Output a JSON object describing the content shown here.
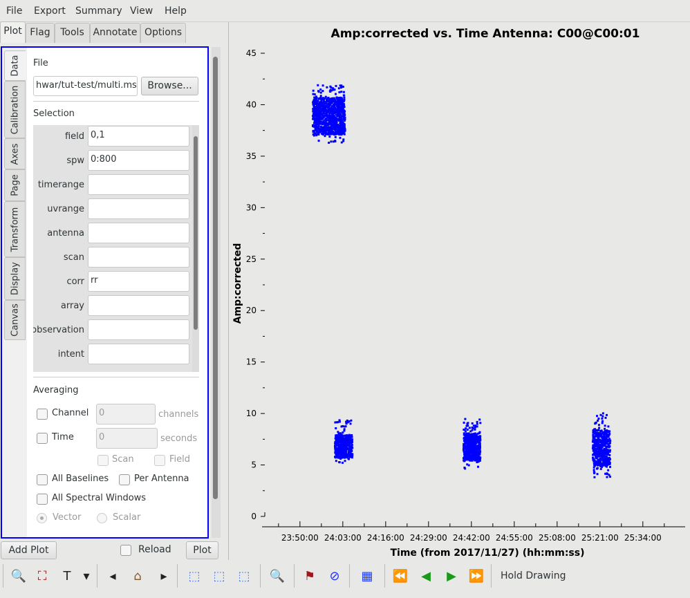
{
  "menubar": {
    "items": [
      "File",
      "Export",
      "Summary",
      "View",
      "Help"
    ]
  },
  "top_tabs": [
    {
      "label": "Plot",
      "active": true
    },
    {
      "label": "Flag"
    },
    {
      "label": "Tools"
    },
    {
      "label": "Annotate"
    },
    {
      "label": "Options"
    }
  ],
  "side_tabs": [
    {
      "label": "Data",
      "active": true
    },
    {
      "label": "Calibration"
    },
    {
      "label": "Axes"
    },
    {
      "label": "Page"
    },
    {
      "label": "Transform"
    },
    {
      "label": "Display"
    },
    {
      "label": "Canvas"
    }
  ],
  "data_tab": {
    "file_heading": "File",
    "file_value": "hwar/tut-test/multi.ms",
    "browse_label": "Browse...",
    "selection_heading": "Selection",
    "selection_fields": [
      {
        "label": "field",
        "value": "0,1"
      },
      {
        "label": "spw",
        "value": "0:800"
      },
      {
        "label": "timerange",
        "value": ""
      },
      {
        "label": "uvrange",
        "value": ""
      },
      {
        "label": "antenna",
        "value": ""
      },
      {
        "label": "scan",
        "value": ""
      },
      {
        "label": "corr",
        "value": "rr"
      },
      {
        "label": "array",
        "value": ""
      },
      {
        "label": "observation",
        "value": ""
      },
      {
        "label": "intent",
        "value": ""
      }
    ],
    "averaging_heading": "Averaging",
    "channel_label": "Channel",
    "channel_value": "0",
    "channel_unit": "channels",
    "time_label": "Time",
    "time_value": "0",
    "time_unit": "seconds",
    "scan_label": "Scan",
    "field_label": "Field",
    "all_baselines_label": "All Baselines",
    "per_antenna_label": "Per Antenna",
    "all_spw_label": "All Spectral Windows",
    "vector_label": "Vector",
    "scalar_label": "Scalar",
    "vector_selected": true
  },
  "bottom": {
    "add_plot": "Add Plot",
    "reload": "Reload",
    "plot": "Plot"
  },
  "toolbar": {
    "icons": [
      "zoom-icon",
      "panel-full-icon",
      "annotate-text-icon",
      "dropdown-arrow-icon",
      "step-back-icon",
      "home-icon",
      "step-forward-icon",
      "mark-region-icon",
      "subtract-region-icon",
      "clear-regions-icon",
      "locate-icon",
      "flag-icon",
      "unflag-icon",
      "flag-extend-icon",
      "iterate-first-icon",
      "iterate-prev-icon",
      "iterate-next-icon",
      "iterate-last-icon"
    ],
    "hold_drawing": "Hold Drawing"
  },
  "chart_data": {
    "type": "scatter",
    "title": "Amp:corrected vs. Time Antenna: C00@C00:01",
    "xlabel": "Time (from 2017/11/27) (hh:mm:ss)",
    "ylabel": "Amp:corrected",
    "xticks": [
      "23:50:00",
      "24:03:00",
      "24:16:00",
      "24:29:00",
      "24:42:00",
      "24:55:00",
      "25:08:00",
      "25:21:00",
      "25:34:00"
    ],
    "xlim": [
      "23:38:30",
      "25:46:50"
    ],
    "yticks": [
      0,
      5,
      10,
      15,
      20,
      25,
      30,
      35,
      40,
      45
    ],
    "ylim": [
      0,
      45
    ],
    "grid": false,
    "color": "#0000ff",
    "clusters": [
      {
        "time_start": "23:53:36",
        "time_end": "24:03:24",
        "amp_core": [
          37.2,
          40.8
        ],
        "amp_range": [
          36.4,
          42.0
        ]
      },
      {
        "time_start": "24:00:18",
        "time_end": "24:05:36",
        "amp_core": [
          5.8,
          8.0
        ],
        "amp_range": [
          5.3,
          9.5
        ]
      },
      {
        "time_start": "24:39:18",
        "time_end": "24:44:24",
        "amp_core": [
          5.5,
          8.2
        ],
        "amp_range": [
          4.5,
          9.7
        ]
      },
      {
        "time_start": "25:18:30",
        "time_end": "25:23:48",
        "amp_core": [
          5.0,
          8.5
        ],
        "amp_range": [
          3.7,
          10.2
        ]
      }
    ]
  }
}
